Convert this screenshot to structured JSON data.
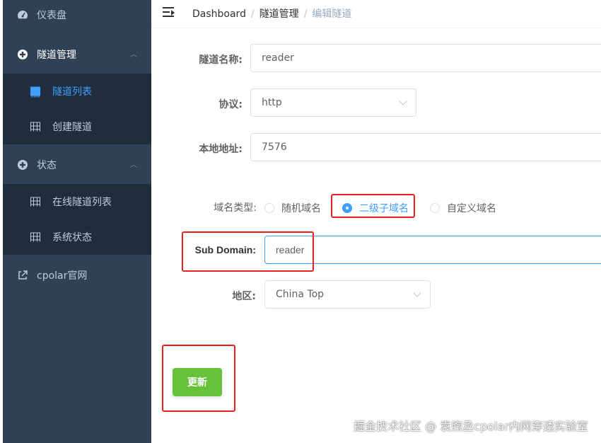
{
  "sidebar": {
    "dashboard_label": "仪表盘",
    "tunnel_mgmt_label": "隧道管理",
    "tunnel_list_label": "隧道列表",
    "create_tunnel_label": "创建隧道",
    "status_label": "状态",
    "online_tunnels_label": "在线隧道列表",
    "system_status_label": "系统状态",
    "cpolar_site_label": "cpolar官网"
  },
  "header": {
    "breadcrumb": [
      "Dashboard",
      "隧道管理",
      "编辑隧道"
    ],
    "separator": "/"
  },
  "form": {
    "tunnel_name_label": "隧道名称:",
    "tunnel_name_value": "reader",
    "protocol_label": "协议:",
    "protocol_value": "http",
    "local_addr_label": "本地地址:",
    "local_addr_value": "7576",
    "domain_type_label": "域名类型:",
    "domain_type_options": [
      "随机域名",
      "二级子域名",
      "自定义域名"
    ],
    "domain_type_selected": "二级子域名",
    "subdomain_label": "Sub Domain:",
    "subdomain_value": "reader",
    "region_label": "地区:",
    "region_value": "China Top",
    "update_button": "更新"
  },
  "watermark": "掘金技术社区 @ 袁煦丞cpolar内网穿透实验室",
  "colors": {
    "sidebar_bg": "#304156",
    "submenu_bg": "#1f2d3d",
    "accent": "#409eff",
    "success": "#67c23a",
    "highlight": "#e8231f"
  }
}
